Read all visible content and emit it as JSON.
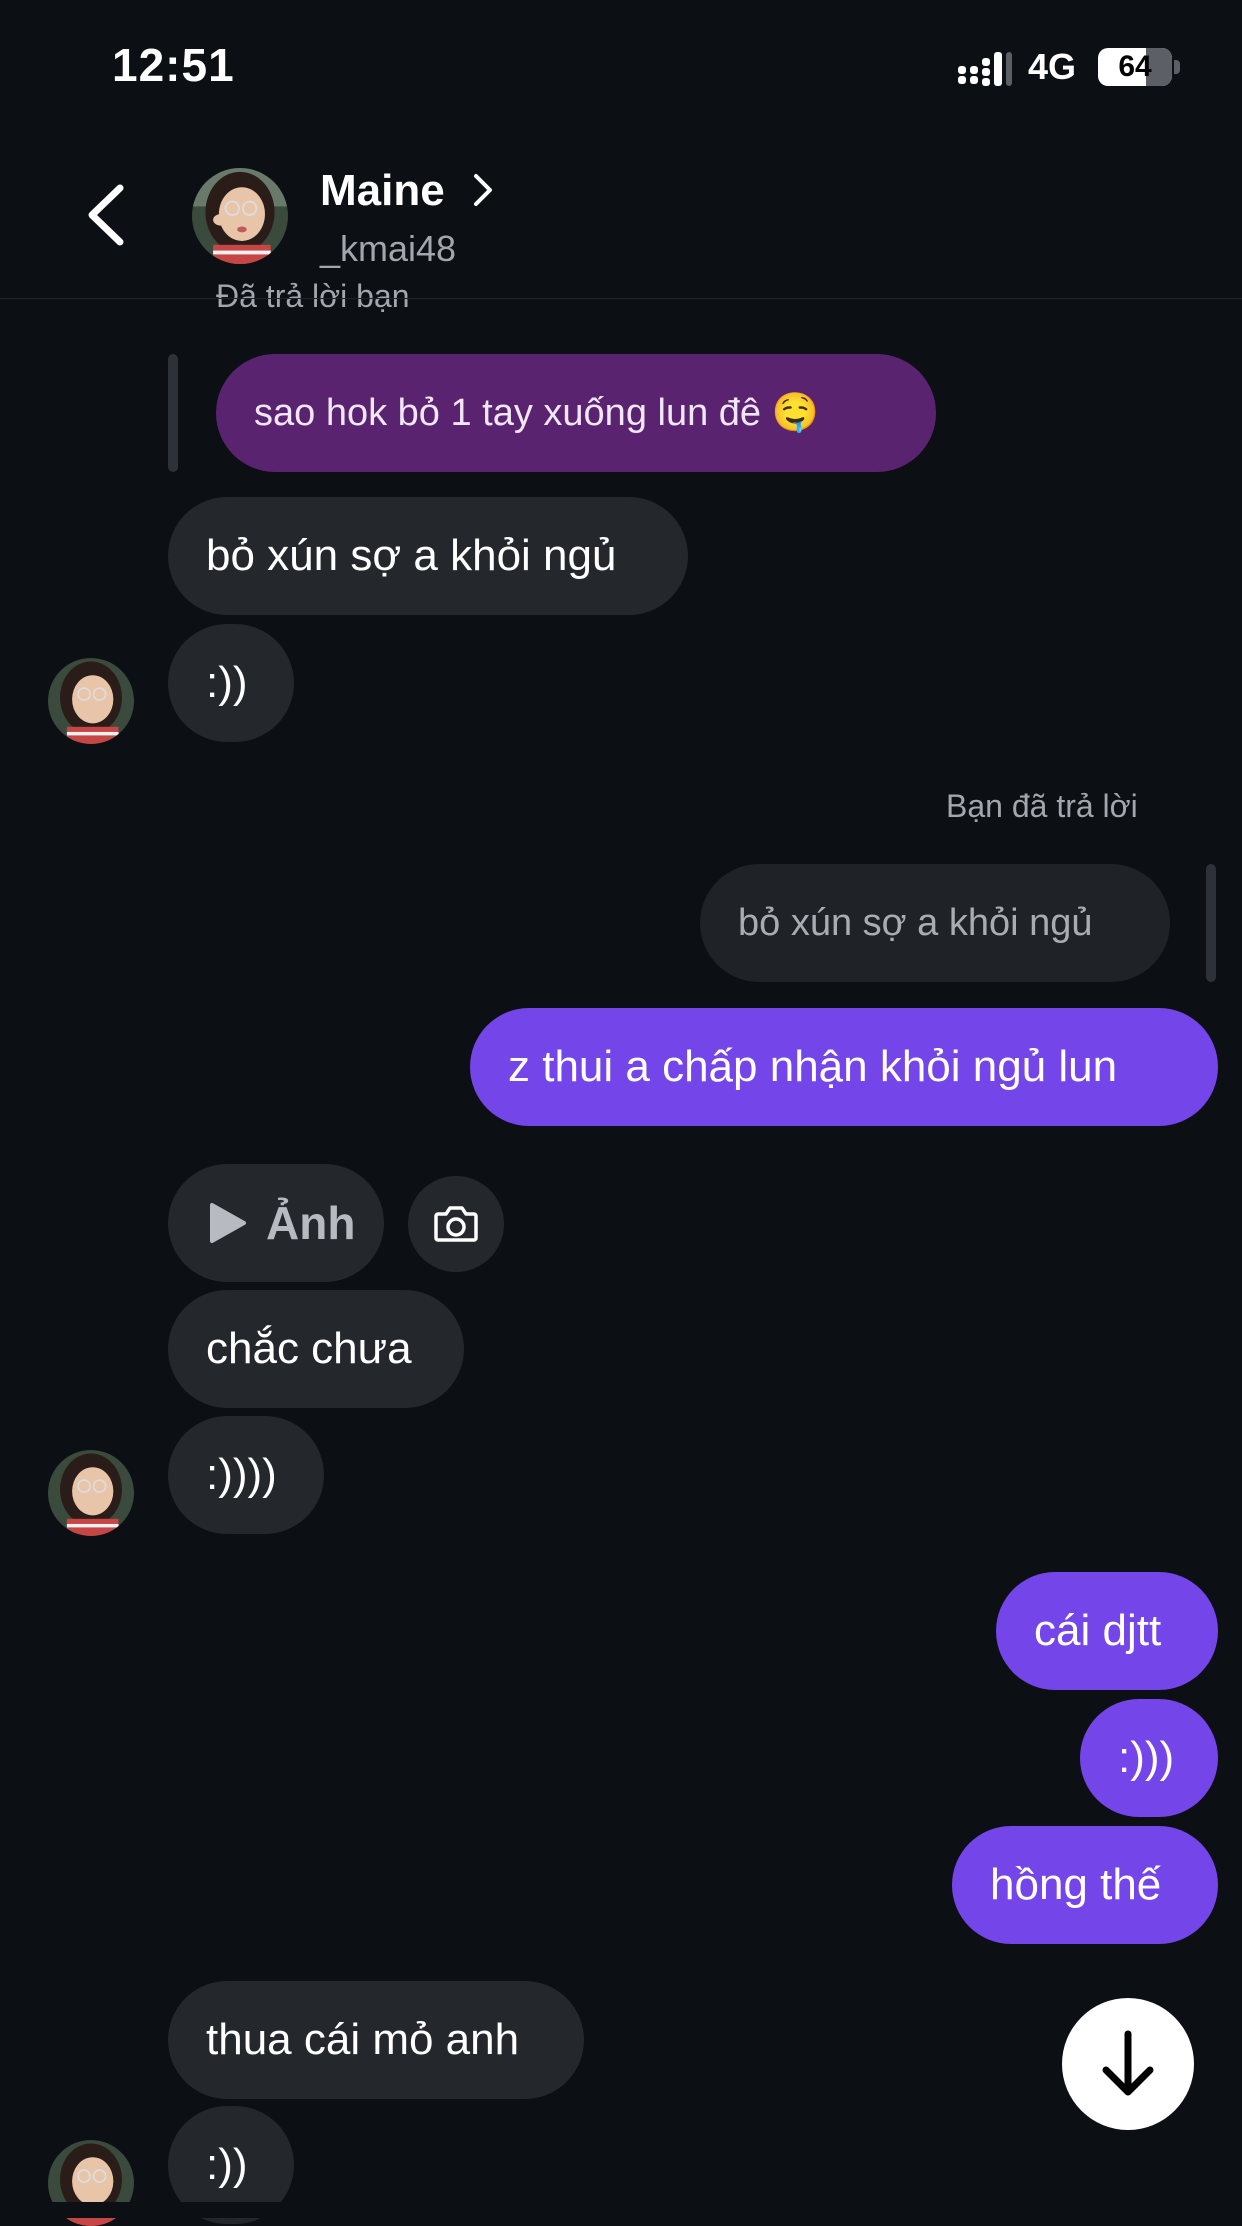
{
  "status_bar": {
    "time": "12:51",
    "network": "4G",
    "battery": "64"
  },
  "header": {
    "name": "Maine",
    "username": "_kmai48"
  },
  "messages": {
    "reply_label_top": "Đã trả lời bạn",
    "quoted_top": "sao hok bỏ 1 tay xuống lun đê 🤤",
    "in_1": "bỏ xún sợ a khỏi ngủ",
    "in_2": ":))",
    "reply_label_you": "Bạn đã trả lời",
    "quoted_you": "bỏ xún sợ a khỏi ngủ",
    "out_1": "z thui a chấp nhận khỏi ngủ lun",
    "photo_label": "Ảnh",
    "in_3": "chắc chưa",
    "in_4": ":))))",
    "out_2": "cái djtt",
    "out_3": ":)))",
    "out_4": "hồng thế",
    "in_5": "thua cái mỏ anh",
    "in_6": ":))"
  },
  "colors": {
    "background": "#0c0f14",
    "incoming_bubble": "#24272c",
    "outgoing_bubble": "#7445e8",
    "quoted_incoming": "#5a2370"
  },
  "icons": [
    "back-chevron-icon",
    "chevron-right-icon",
    "signal-icon",
    "battery-icon",
    "play-icon",
    "camera-icon",
    "arrow-down-icon"
  ]
}
